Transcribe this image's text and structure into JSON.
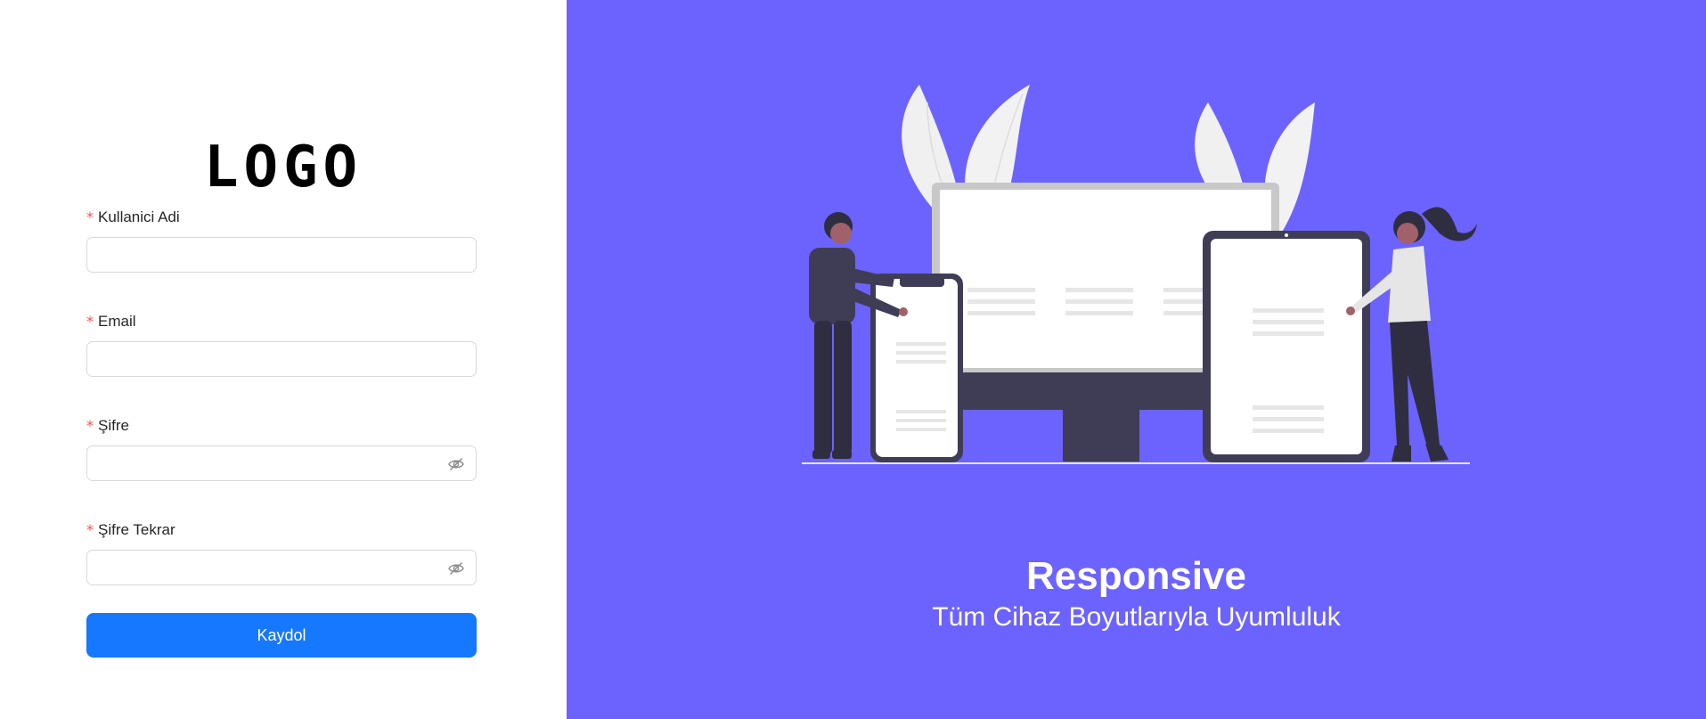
{
  "logo": {
    "text": "LOGO"
  },
  "form": {
    "fields": [
      {
        "label": "Kullanici Adi",
        "required_mark": "*",
        "value": "",
        "type": "text"
      },
      {
        "label": "Email",
        "required_mark": "*",
        "value": "",
        "type": "email"
      },
      {
        "label": "Şifre",
        "required_mark": "*",
        "value": "",
        "type": "password"
      },
      {
        "label": "Şifre Tekrar",
        "required_mark": "*",
        "value": "",
        "type": "password"
      }
    ],
    "submit_label": "Kaydol"
  },
  "hero": {
    "title": "Responsive",
    "subtitle": "Tüm Cihaz Boyutlarıyla Uyumluluk"
  },
  "colors": {
    "accent": "#1677ff",
    "hero_background": "#6c63ff",
    "required": "#ff4d4f",
    "input_border": "#d9d9d9"
  },
  "icons": {
    "password_toggle": "eye-invisible-icon"
  }
}
